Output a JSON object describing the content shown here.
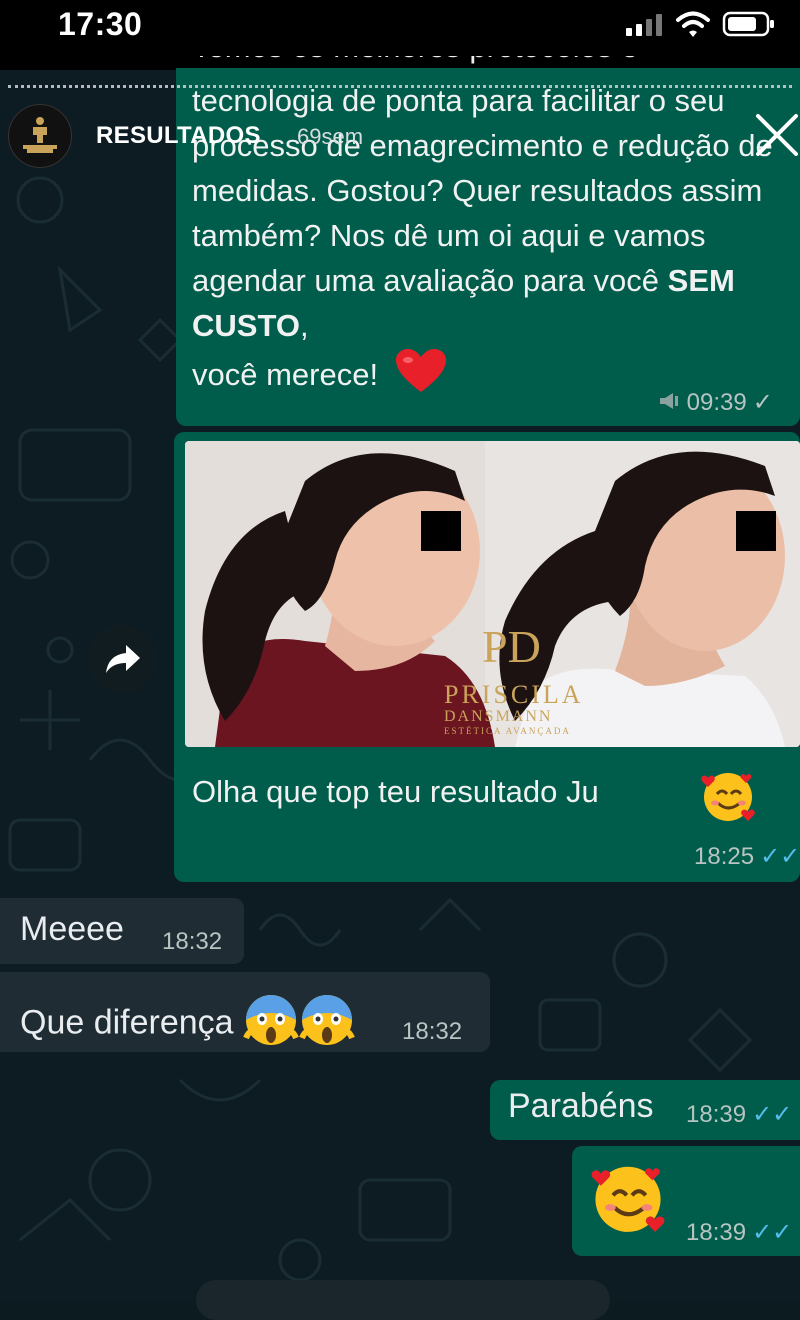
{
  "status_bar": {
    "time": "17:30"
  },
  "story": {
    "title": "RESULTADOS",
    "age": "69sem"
  },
  "messages": [
    {
      "direction": "out",
      "text_partial_top": "Temos os melhores protocolos e",
      "text_lines_before_bold": "tecnologia de ponta para facilitar o seu processo de emagrecimento e redução de medidas. Gostou? Quer resultados assim também? Nos dê um oi aqui e vamos agendar uma avaliação para você",
      "bold": "SEM CUSTO",
      "text_after_bold": ",",
      "last_line": "você merece!",
      "emoji": "red-heart",
      "time": "09:39",
      "status": "sent"
    },
    {
      "direction": "out",
      "image": {
        "logo_text": "PRISCILA",
        "logo_sub": "DANSMANN",
        "logo_tag": "ESTÉTICA AVANÇADA",
        "logo_mark": "PD"
      },
      "caption": "Olha que top teu resultado Ju",
      "emoji": "smiling-face-with-hearts",
      "time": "18:25",
      "status": "read"
    },
    {
      "direction": "in",
      "text": "Meeee",
      "time": "18:32"
    },
    {
      "direction": "in",
      "text": "Que diferença",
      "emoji": "face-screaming-in-fear",
      "time": "18:32"
    },
    {
      "direction": "out",
      "text": "Parabéns",
      "time": "18:39",
      "status": "read"
    },
    {
      "direction": "out",
      "emoji": "smiling-face-with-hearts",
      "time": "18:39",
      "status": "read"
    }
  ],
  "icons": {
    "forward": "forward-arrow-icon",
    "close": "close-icon",
    "read": "double-check-icon",
    "sent": "single-check-icon"
  },
  "colors": {
    "outgoing": "#005c4b",
    "incoming": "#1f2c34",
    "read_tick": "#53bdeb",
    "background": "#0d1c22"
  }
}
